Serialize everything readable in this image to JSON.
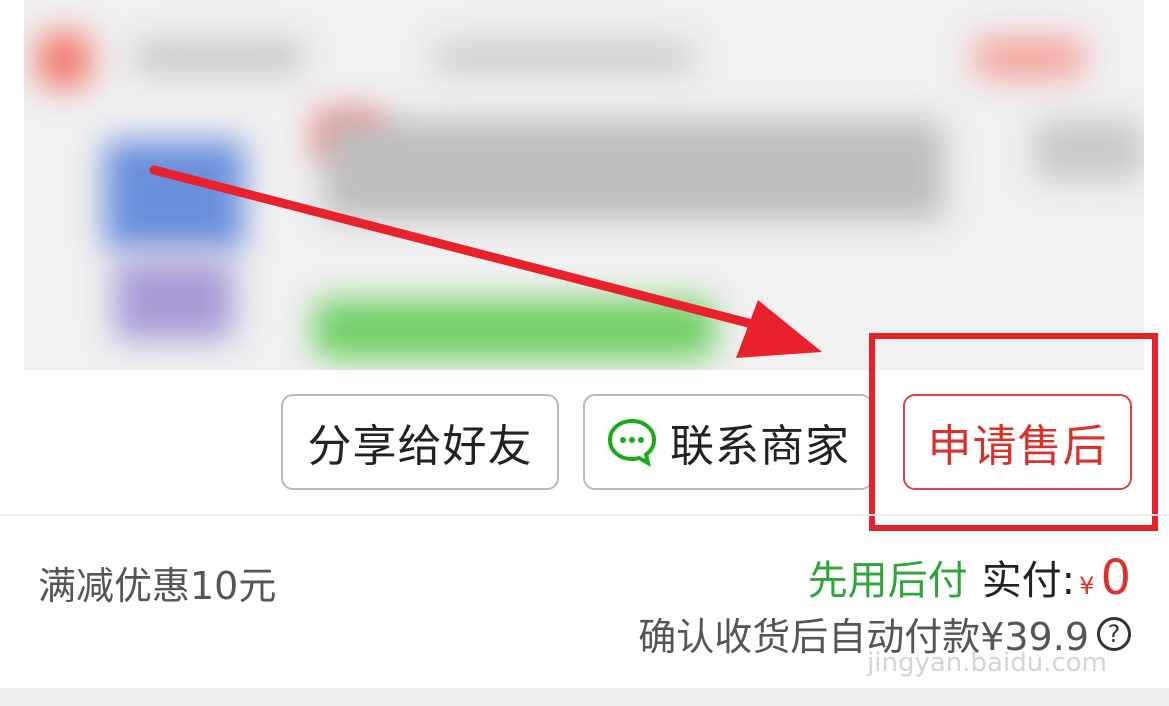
{
  "buttons": {
    "share": "分享给好友",
    "contact": "联系商家",
    "after_sale": "申请售后"
  },
  "order": {
    "discount": "满减优惠10元",
    "pay_later": "先用后付",
    "paid_label": "实付:",
    "currency": "¥",
    "paid_value": "0",
    "auto_pay_note": "确认收货后自动付款¥39.9",
    "help": "?"
  },
  "watermark": "jingyan.baidu.com",
  "colors": {
    "accent_red": "#e0302b",
    "annotation_red": "#e8212c",
    "pay_later_green": "#2ea63a",
    "wechat_green": "#1aad19"
  },
  "icons": {
    "contact": "chat-bubble-icon",
    "help": "question-circle-icon"
  }
}
